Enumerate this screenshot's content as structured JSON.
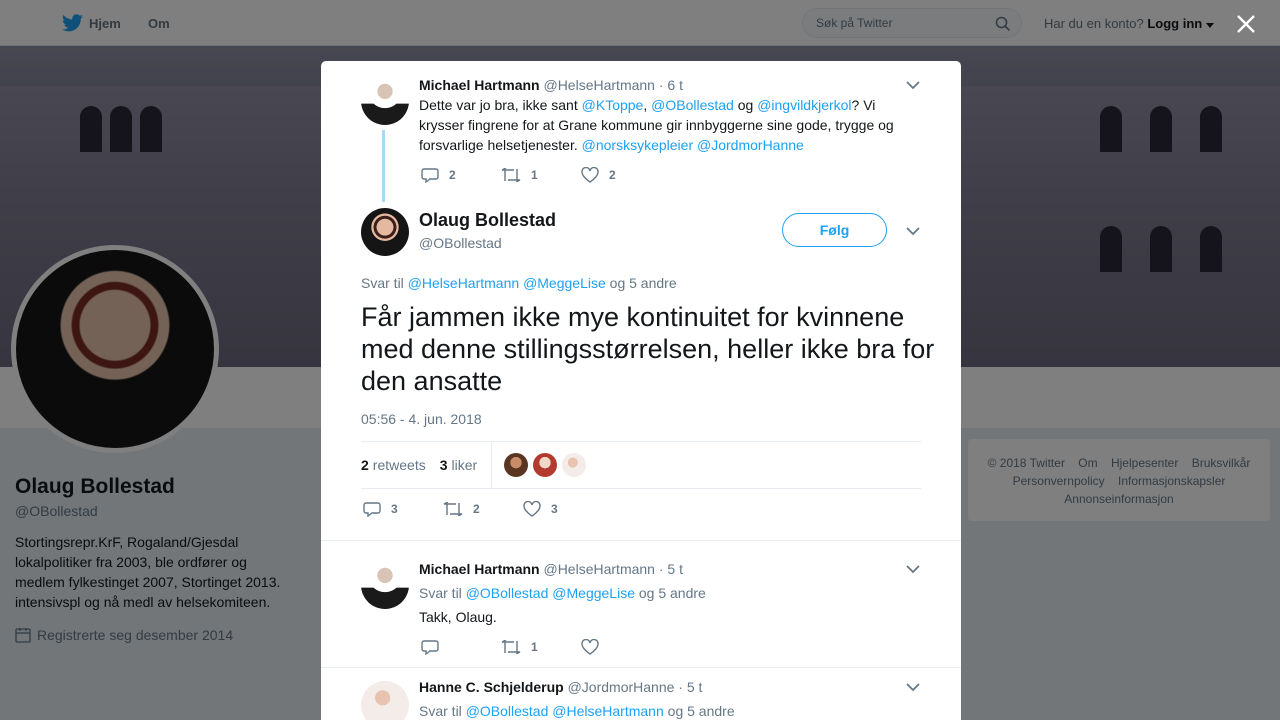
{
  "nav": {
    "home": "Hjem",
    "about": "Om",
    "search_placeholder": "Søk på Twitter",
    "account_prompt": "Har du en konto?",
    "login": "Logg inn"
  },
  "profile": {
    "name": "Olaug Bollestad",
    "handle": "@OBollestad",
    "bio": "Stortingsrepr.KrF, Rogaland/Gjesdal lokalpolitiker fra 2003, ble ordfører og medlem fylkestinget 2007, Stortinget 2013. intensivspl og nå medl av helsekomiteen.",
    "joined": "Registrerte seg desember 2014"
  },
  "footer": {
    "links": [
      "© 2018 Twitter",
      "Om",
      "Hjelpesenter",
      "Bruksvilkår",
      "Personvernpolicy",
      "Informasjonskapsler",
      "Annonseinformasjon"
    ]
  },
  "parent_tweet": {
    "name": "Michael Hartmann",
    "handle": "@HelseHartmann",
    "time": "· 6 t",
    "text_before": "Dette var jo bra, ikke sant ",
    "m1": "@KToppe",
    "comma": ", ",
    "m2": "@OBollestad",
    "og": " og ",
    "m3": "@ingvildkjerkol",
    "text_after": "? Vi krysser fingrene for at Grane kommune gir innbyggerne sine gode, trygge og forsvarlige helsetjenester. ",
    "m4": "@norsksykepleier",
    "space": " ",
    "m5": "@JordmorHanne",
    "replies": "2",
    "retweets": "1",
    "likes": "2"
  },
  "main_tweet": {
    "name": "Olaug Bollestad",
    "handle": "@OBollestad",
    "follow": "Følg",
    "reply_prefix": "Svar til ",
    "reply_m1": "@HelseHartmann",
    "reply_m2": "@MeggeLise",
    "reply_suffix": " og 5 andre",
    "text": "Får jammen ikke mye kontinuitet for kvinnene med denne stillingsstørrelsen, heller ikke bra for den ansatte",
    "timestamp": "05:56 - 4. jun. 2018",
    "retweet_count": "2",
    "retweet_label": "retweets",
    "like_count": "3",
    "like_label": "liker",
    "replies": "3",
    "retweets": "2",
    "likes": "3"
  },
  "reply1": {
    "name": "Michael Hartmann",
    "handle": "@HelseHartmann",
    "time": "· 5 t",
    "reply_prefix": "Svar til ",
    "reply_m1": "@OBollestad",
    "reply_m2": "@MeggeLise",
    "reply_suffix": " og 5 andre",
    "text": "Takk, Olaug.",
    "retweets": "1"
  },
  "reply2": {
    "name": "Hanne C. Schjelderup",
    "handle": "@JordmorHanne",
    "time": "· 5 t",
    "reply_prefix": "Svar til ",
    "reply_m1": "@OBollestad",
    "reply_m2": "@HelseHartmann",
    "reply_suffix": " og 5 andre"
  },
  "colors": {
    "accent": "#1da1f2",
    "muted": "#657786",
    "thread_line": "#a8daf9"
  }
}
